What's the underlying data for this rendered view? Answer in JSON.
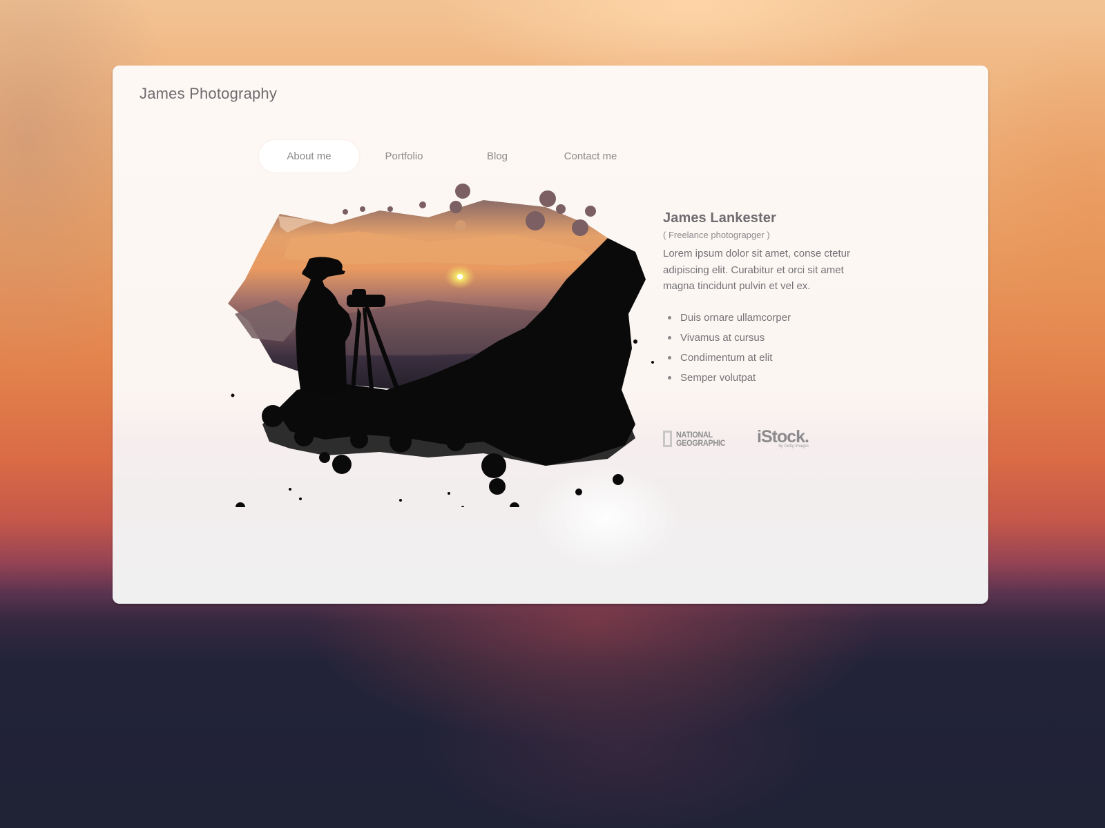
{
  "site": {
    "title": "James Photography"
  },
  "nav": {
    "items": [
      {
        "label": "About me",
        "active": true
      },
      {
        "label": "Portfolio",
        "active": false
      },
      {
        "label": "Blog",
        "active": false
      },
      {
        "label": "Contact me",
        "active": false
      }
    ]
  },
  "hero": {
    "image_alt": "silhouette-photographer-sunset-ink-splash"
  },
  "profile": {
    "name": "James Lankester",
    "role": "( Freelance photograpger )",
    "bio": "Lorem ipsum dolor sit amet, conse ctetur adipiscing elit. Curabitur et orci sit amet magna tincidunt pulvin et vel ex.",
    "bullets": [
      "Duis ornare ullamcorper",
      "Vivamus at cursus",
      "Condimentum at elit",
      "Semper volutpat"
    ]
  },
  "clients": {
    "natgeo_line1": "NATIONAL",
    "natgeo_line2": "GEOGRAPHIC",
    "istock_main": "iStock.",
    "istock_sub": "by Getty Images"
  },
  "colors": {
    "text_primary": "#6e6c70",
    "text_secondary": "#8c8a8c",
    "card_bg": "#fdf8f4",
    "bg_top": "#f3c393",
    "bg_bottom": "#202236"
  }
}
